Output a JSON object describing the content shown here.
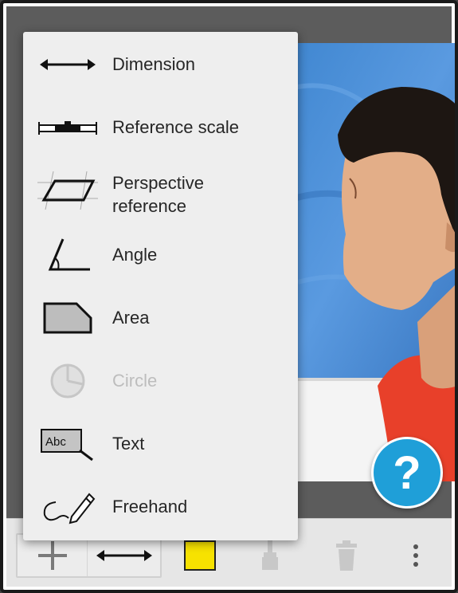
{
  "menu": {
    "items": [
      {
        "label": "Dimension",
        "icon": "dimension-arrow-icon",
        "enabled": true
      },
      {
        "label": "Reference scale",
        "icon": "reference-scale-icon",
        "enabled": true
      },
      {
        "label": "Perspective reference",
        "label_line1": "Perspective",
        "label_line2": "reference",
        "icon": "perspective-grid-icon",
        "enabled": true
      },
      {
        "label": "Angle",
        "icon": "angle-icon",
        "enabled": true
      },
      {
        "label": "Area",
        "icon": "area-polygon-icon",
        "enabled": true
      },
      {
        "label": "Circle",
        "icon": "circle-icon",
        "enabled": false
      },
      {
        "label": "Text",
        "icon": "text-box-icon",
        "enabled": true
      },
      {
        "label": "Freehand",
        "icon": "freehand-pencil-icon",
        "enabled": true
      }
    ]
  },
  "help_button": {
    "label": "?"
  },
  "toolbar": {
    "add_icon": "plus-icon",
    "current_tool_icon": "dimension-arrow-icon",
    "color_swatch": "#f7e200",
    "brush_icon": "brush-icon",
    "trash_icon": "trash-icon",
    "more_icon": "overflow-dots-icon"
  },
  "colors": {
    "accent": "#1f9fd8",
    "menu_bg": "#eeeeee",
    "disabled_text": "#bdbdbd"
  }
}
